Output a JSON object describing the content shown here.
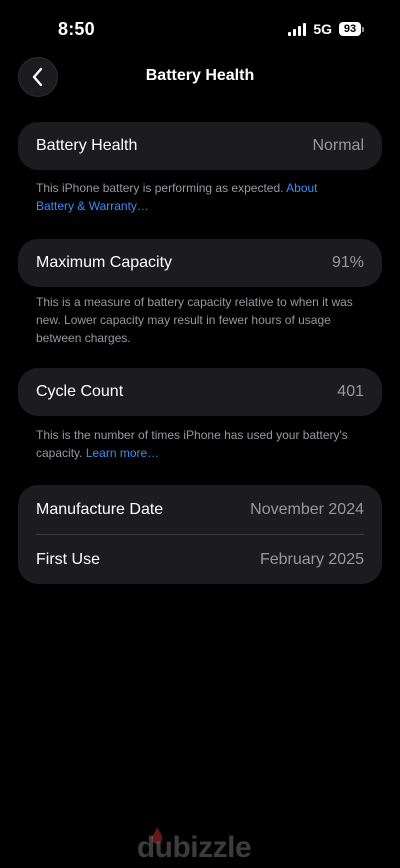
{
  "status_bar": {
    "time": "8:50",
    "network": "5G",
    "battery_level": "93"
  },
  "nav": {
    "title": "Battery Health",
    "back_icon": "chevron-left-icon"
  },
  "battery_health": {
    "label": "Battery Health",
    "value": "Normal",
    "footnote": "This iPhone battery is performing as expected.",
    "link": "About Battery & Warranty…"
  },
  "maximum_capacity": {
    "label": "Maximum Capacity",
    "value": "91%",
    "footnote": "This is a measure of battery capacity relative to when it was new. Lower capacity may result in fewer hours of usage between charges."
  },
  "cycle_count": {
    "label": "Cycle Count",
    "value": "401",
    "footnote": "This is the number of times iPhone has used your battery's capacity.",
    "link": "Learn more…"
  },
  "dates": {
    "manufacture_label": "Manufacture Date",
    "manufacture_value": "November 2024",
    "first_use_label": "First Use",
    "first_use_value": "February 2025"
  },
  "watermark": {
    "text": "dubizzle"
  },
  "colors": {
    "background": "#000000",
    "group_background": "#1c1c1e",
    "secondary_text": "#98989f",
    "link": "#3b8cf6"
  }
}
